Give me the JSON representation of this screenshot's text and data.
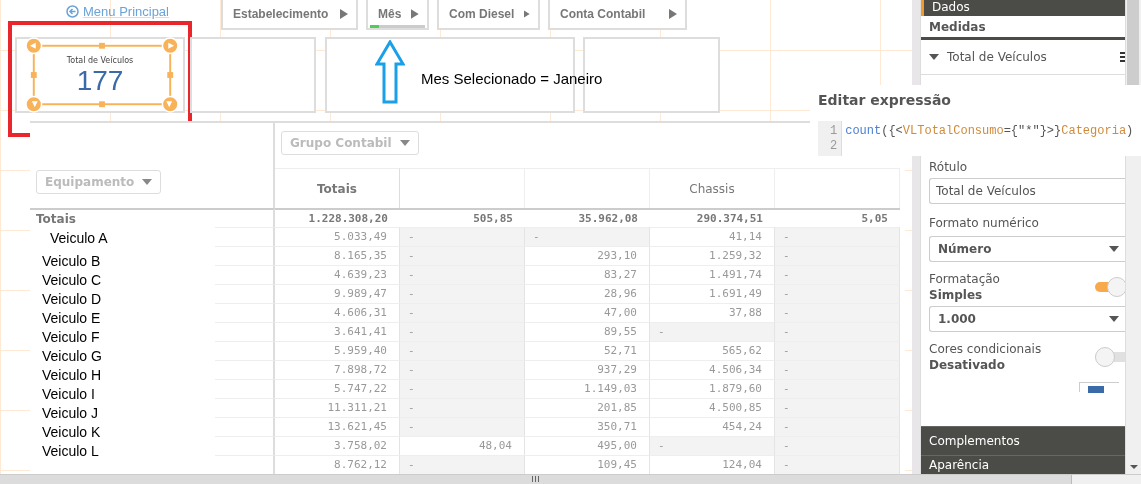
{
  "menu_link": {
    "label": "Menu Principal"
  },
  "filters": [
    {
      "label": "Estabelecimento",
      "selected": false
    },
    {
      "label": "Mês",
      "selected": true
    },
    {
      "label": "Com Diesel",
      "selected": false
    },
    {
      "label": "Conta Contabil",
      "selected": false
    }
  ],
  "kpi": {
    "title": "Total de Veículos",
    "value": "177",
    "selected": true
  },
  "annotation": {
    "text": "Mes Selecionado = Janeiro"
  },
  "table": {
    "column_dropdown": "Grupo Contabil",
    "row_dropdown": "Equipamento",
    "columns": [
      {
        "label": "Totais"
      },
      {},
      {},
      {
        "label": "Chassis"
      },
      {}
    ],
    "totals": {
      "label": "Totais",
      "values": [
        "1.228.308,20",
        "505,85",
        "35.962,08",
        "290.374,51",
        "5,05"
      ]
    },
    "rows": [
      {
        "name": "Veiculo A",
        "cells": [
          {
            "text": "5.033,49"
          },
          {
            "text": "-",
            "empty": true
          },
          {
            "text": "-",
            "empty": true
          },
          {
            "text": "41,14"
          },
          {
            "text": "-",
            "empty": true
          }
        ]
      },
      {
        "name": "Veiculo B",
        "cells": [
          {
            "text": "8.165,35"
          },
          {
            "text": "-",
            "empty": true
          },
          {
            "text": "293,10"
          },
          {
            "text": "1.259,32"
          },
          {
            "text": "-",
            "empty": true
          }
        ]
      },
      {
        "name": "Veiculo C",
        "cells": [
          {
            "text": "4.639,23"
          },
          {
            "text": "-",
            "empty": true
          },
          {
            "text": "83,27"
          },
          {
            "text": "1.491,74"
          },
          {
            "text": "-",
            "empty": true
          }
        ]
      },
      {
        "name": "Veiculo D",
        "cells": [
          {
            "text": "9.989,47"
          },
          {
            "text": "-",
            "empty": true
          },
          {
            "text": "28,96"
          },
          {
            "text": "1.691,49"
          },
          {
            "text": "-",
            "empty": true
          }
        ]
      },
      {
        "name": "Veiculo E",
        "cells": [
          {
            "text": "4.606,31"
          },
          {
            "text": "-",
            "empty": true
          },
          {
            "text": "47,00"
          },
          {
            "text": "37,88"
          },
          {
            "text": "-",
            "empty": true
          }
        ]
      },
      {
        "name": "Veiculo F",
        "cells": [
          {
            "text": "3.641,41"
          },
          {
            "text": "-",
            "empty": true
          },
          {
            "text": "89,55"
          },
          {
            "text": "-",
            "empty": true
          },
          {
            "text": "-",
            "empty": true
          }
        ]
      },
      {
        "name": "Veiculo G",
        "cells": [
          {
            "text": "5.959,40"
          },
          {
            "text": "-",
            "empty": true
          },
          {
            "text": "52,71"
          },
          {
            "text": "565,62"
          },
          {
            "text": "-",
            "empty": true
          }
        ]
      },
      {
        "name": "Veiculo H",
        "cells": [
          {
            "text": "7.898,72"
          },
          {
            "text": "-",
            "empty": true
          },
          {
            "text": "937,29"
          },
          {
            "text": "4.506,34"
          },
          {
            "text": "-",
            "empty": true
          }
        ]
      },
      {
        "name": "Veiculo I",
        "cells": [
          {
            "text": "5.747,22"
          },
          {
            "text": "-",
            "empty": true
          },
          {
            "text": "1.149,03"
          },
          {
            "text": "1.879,60"
          },
          {
            "text": "-",
            "empty": true
          }
        ]
      },
      {
        "name": "Veiculo J",
        "cells": [
          {
            "text": "11.311,21"
          },
          {
            "text": "-",
            "empty": true
          },
          {
            "text": "201,85"
          },
          {
            "text": "4.500,85"
          },
          {
            "text": "-",
            "empty": true
          }
        ]
      },
      {
        "name": "Veiculo K",
        "cells": [
          {
            "text": "13.621,45"
          },
          {
            "text": "-",
            "empty": true
          },
          {
            "text": "350,71"
          },
          {
            "text": "454,24"
          },
          {
            "text": "-",
            "empty": true
          }
        ]
      },
      {
        "name": "Veiculo L",
        "cells": [
          {
            "text": "3.758,02"
          },
          {
            "text": "48,04"
          },
          {
            "text": "495,00"
          },
          {
            "text": "-",
            "empty": true
          },
          {
            "text": "-",
            "empty": true
          }
        ]
      },
      {
        "cells": [
          {
            "text": "8.762,12"
          },
          {
            "text": "-",
            "empty": true
          },
          {
            "text": "109,45"
          },
          {
            "text": "124,04"
          },
          {
            "text": "-",
            "empty": true
          }
        ]
      }
    ]
  },
  "editor": {
    "title": "Editar expressão",
    "lines": [
      {
        "number": "1",
        "tokens": [
          {
            "kind": "function",
            "text": "count"
          },
          {
            "kind": "punct",
            "text": "({<"
          },
          {
            "kind": "field",
            "text": "VLTotalConsumo"
          },
          {
            "kind": "punct",
            "text": "={\"*\"}>}"
          },
          {
            "kind": "field",
            "text": "Categoria"
          },
          {
            "kind": "punct",
            "text": ")"
          }
        ]
      },
      {
        "number": "2"
      }
    ]
  },
  "panel": {
    "header": "Dados",
    "section": "Medidas",
    "measure": {
      "label": "Total de Veículos",
      "expanded": true
    },
    "fields": [
      {
        "kind": "input",
        "label": "Rótulo",
        "value": "Total de Veículos"
      },
      {
        "kind": "select",
        "label": "Formato numérico",
        "value": "Número"
      },
      {
        "kind": "toggle",
        "label": "Formatação",
        "status": "Simples",
        "on": true
      },
      {
        "kind": "select",
        "value": "1.000"
      },
      {
        "kind": "toggle",
        "label": "Cores condicionais",
        "status": "Desativado",
        "on": false
      }
    ],
    "sections": [
      "Complementos",
      "Aparência"
    ]
  }
}
